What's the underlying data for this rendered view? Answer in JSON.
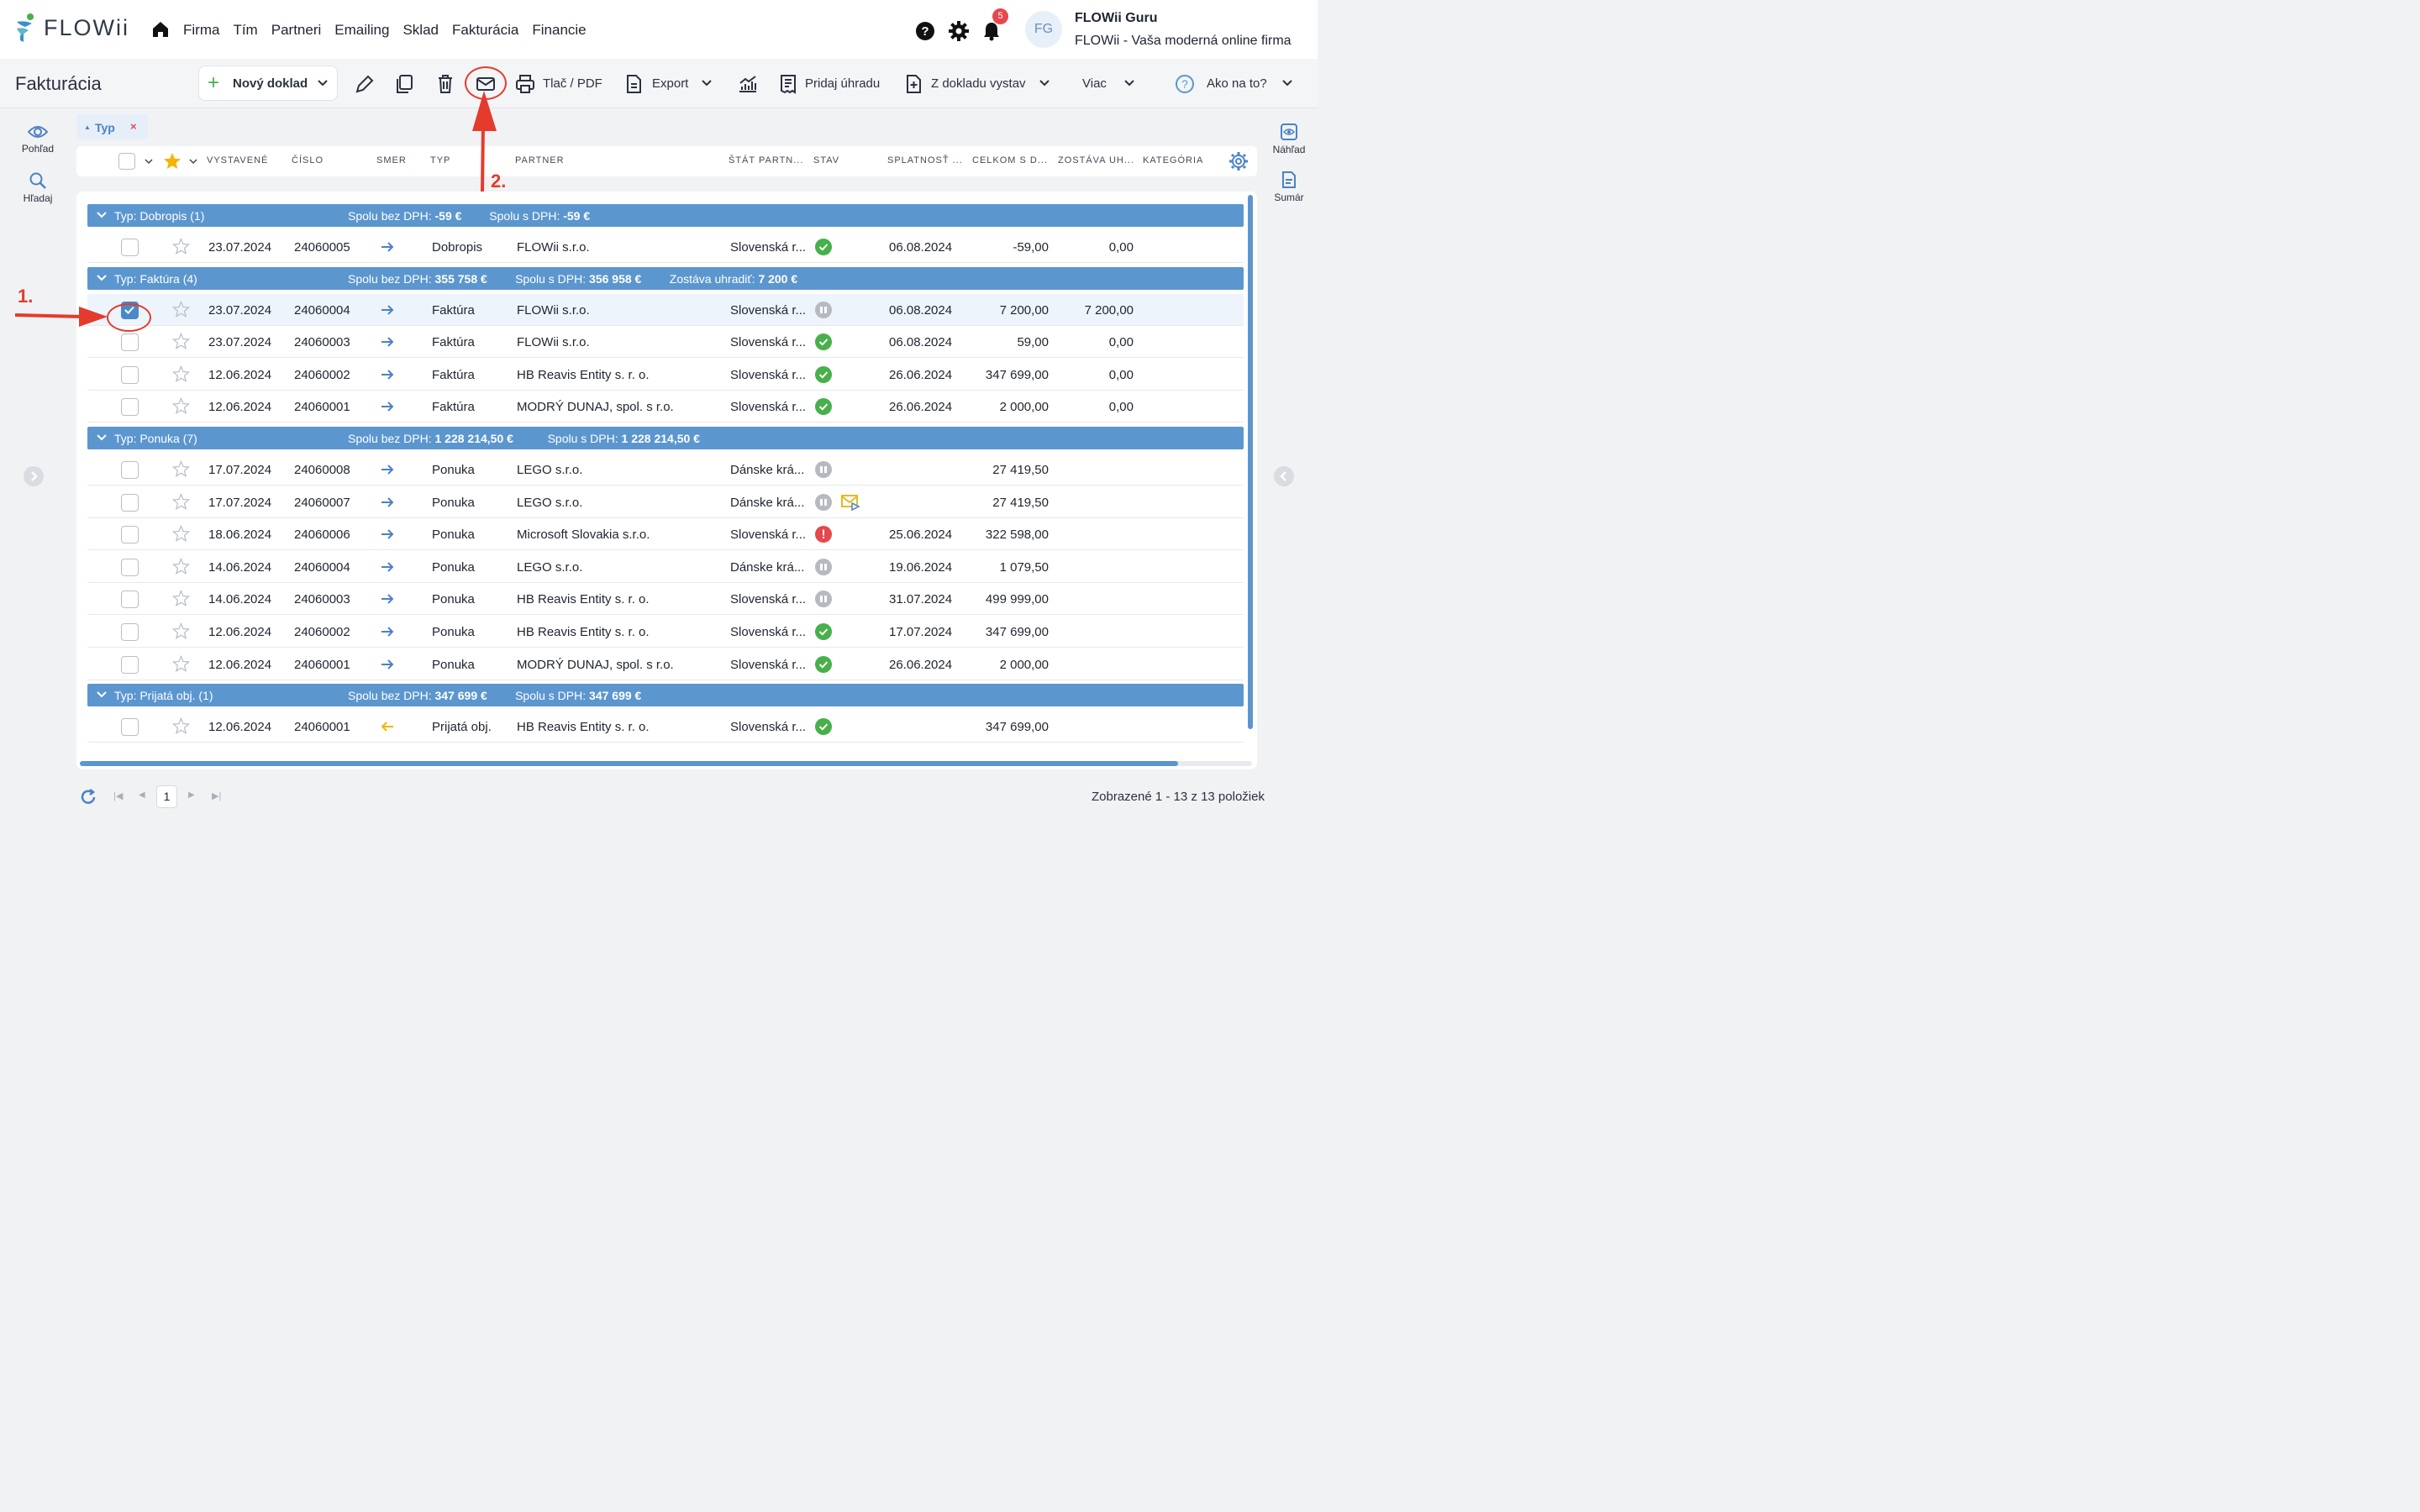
{
  "app": {
    "logo_text": "FLOWii",
    "nav": [
      "Firma",
      "Tím",
      "Partneri",
      "Emailing",
      "Sklad",
      "Fakturácia",
      "Financie"
    ],
    "notifications_count": "5",
    "avatar_initials": "FG",
    "user_name": "FLOWii Guru",
    "user_firm": "FLOWii - Vaša moderná online firma"
  },
  "toolbar": {
    "title": "Fakturácia",
    "new_doc": "Nový doklad",
    "print": "Tlač / PDF",
    "export": "Export",
    "add_payment": "Pridaj úhradu",
    "from_doc": "Z dokladu vystav",
    "more": "Viac",
    "help": "Ako na to?"
  },
  "sidebar_left": {
    "view": "Pohľad",
    "search": "Hľadaj"
  },
  "sidebar_right": {
    "preview": "Náhľad",
    "summary": "Sumár"
  },
  "filter_chip": {
    "label": "Typ",
    "remove": "×"
  },
  "columns": [
    "VYSTAVENÉ",
    "ČÍSLO",
    "SMER",
    "TYP",
    "PARTNER",
    "ŠTÁT PARTN...",
    "STAV",
    "SPLATNOSŤ ...",
    "CELKOM S D...",
    "ZOSTÁVA UH...",
    "KATEGÓRIA"
  ],
  "groups": [
    {
      "title": "Typ: Dobropis (1)",
      "sums": [
        {
          "label": "Spolu bez DPH:",
          "value": "-59 €"
        },
        {
          "label": "Spolu s DPH:",
          "value": "-59 €"
        }
      ],
      "rows": [
        {
          "date": "23.07.2024",
          "number": "24060005",
          "dir": "out",
          "type": "Dobropis",
          "partner": "FLOWii s.r.o.",
          "country": "Slovenská r...",
          "status": "paid",
          "due": "06.08.2024",
          "total": "-59,00",
          "remaining": "0,00",
          "checked": false
        }
      ]
    },
    {
      "title": "Typ: Faktúra (4)",
      "sums": [
        {
          "label": "Spolu bez DPH:",
          "value": "355 758 €"
        },
        {
          "label": "Spolu s DPH:",
          "value": "356 958 €"
        },
        {
          "label": "Zostáva uhradiť:",
          "value": "7 200 €"
        }
      ],
      "rows": [
        {
          "date": "23.07.2024",
          "number": "24060004",
          "dir": "out",
          "type": "Faktúra",
          "partner": "FLOWii s.r.o.",
          "country": "Slovenská r...",
          "status": "pending",
          "due": "06.08.2024",
          "total": "7 200,00",
          "remaining": "7 200,00",
          "checked": true
        },
        {
          "date": "23.07.2024",
          "number": "24060003",
          "dir": "out",
          "type": "Faktúra",
          "partner": "FLOWii s.r.o.",
          "country": "Slovenská r...",
          "status": "paid",
          "due": "06.08.2024",
          "total": "59,00",
          "remaining": "0,00",
          "checked": false
        },
        {
          "date": "12.06.2024",
          "number": "24060002",
          "dir": "out",
          "type": "Faktúra",
          "partner": "HB Reavis Entity s. r. o.",
          "country": "Slovenská r...",
          "status": "paid",
          "due": "26.06.2024",
          "total": "347 699,00",
          "remaining": "0,00",
          "checked": false
        },
        {
          "date": "12.06.2024",
          "number": "24060001",
          "dir": "out",
          "type": "Faktúra",
          "partner": "MODRÝ DUNAJ, spol. s r.o.",
          "country": "Slovenská r...",
          "status": "paid",
          "due": "26.06.2024",
          "total": "2 000,00",
          "remaining": "0,00",
          "checked": false
        }
      ]
    },
    {
      "title": "Typ: Ponuka (7)",
      "sums": [
        {
          "label": "Spolu bez DPH:",
          "value": "1 228 214,50 €"
        },
        {
          "label": "Spolu s DPH:",
          "value": "1 228 214,50 €"
        }
      ],
      "rows": [
        {
          "date": "17.07.2024",
          "number": "24060008",
          "dir": "out",
          "type": "Ponuka",
          "partner": "LEGO s.r.o.",
          "country": "Dánske krá...",
          "status": "pending",
          "due": "",
          "total": "27 419,50",
          "remaining": "",
          "checked": false
        },
        {
          "date": "17.07.2024",
          "number": "24060007",
          "dir": "out",
          "type": "Ponuka",
          "partner": "LEGO s.r.o.",
          "country": "Dánske krá...",
          "status": "pending",
          "sent": true,
          "due": "",
          "total": "27 419,50",
          "remaining": "",
          "checked": false
        },
        {
          "date": "18.06.2024",
          "number": "24060006",
          "dir": "out",
          "type": "Ponuka",
          "partner": "Microsoft Slovakia s.r.o.",
          "country": "Slovenská r...",
          "status": "error",
          "due": "25.06.2024",
          "total": "322 598,00",
          "remaining": "",
          "checked": false
        },
        {
          "date": "14.06.2024",
          "number": "24060004",
          "dir": "out",
          "type": "Ponuka",
          "partner": "LEGO s.r.o.",
          "country": "Dánske krá...",
          "status": "pending",
          "due": "19.06.2024",
          "total": "1 079,50",
          "remaining": "",
          "checked": false
        },
        {
          "date": "14.06.2024",
          "number": "24060003",
          "dir": "out",
          "type": "Ponuka",
          "partner": "HB Reavis Entity s. r. o.",
          "country": "Slovenská r...",
          "status": "pending",
          "due": "31.07.2024",
          "total": "499 999,00",
          "remaining": "",
          "checked": false
        },
        {
          "date": "12.06.2024",
          "number": "24060002",
          "dir": "out",
          "type": "Ponuka",
          "partner": "HB Reavis Entity s. r. o.",
          "country": "Slovenská r...",
          "status": "paid",
          "due": "17.07.2024",
          "total": "347 699,00",
          "remaining": "",
          "checked": false
        },
        {
          "date": "12.06.2024",
          "number": "24060001",
          "dir": "out",
          "type": "Ponuka",
          "partner": "MODRÝ DUNAJ, spol. s r.o.",
          "country": "Slovenská r...",
          "status": "paid",
          "due": "26.06.2024",
          "total": "2 000,00",
          "remaining": "",
          "checked": false
        }
      ]
    },
    {
      "title": "Typ: Prijatá obj. (1)",
      "sums": [
        {
          "label": "Spolu bez DPH:",
          "value": "347 699 €"
        },
        {
          "label": "Spolu s DPH:",
          "value": "347 699 €"
        }
      ],
      "rows": [
        {
          "date": "12.06.2024",
          "number": "24060001",
          "dir": "in",
          "type": "Prijatá obj.",
          "partner": "HB Reavis Entity s. r. o.",
          "country": "Slovenská r...",
          "status": "paid",
          "due": "",
          "total": "347 699,00",
          "remaining": "",
          "checked": false
        }
      ]
    }
  ],
  "pager": {
    "page": "1",
    "count_text": "Zobrazené 1 - 13 z 13 položiek"
  },
  "annotations": {
    "step1": "1.",
    "step2": "2."
  },
  "colors": {
    "accent": "#5b96cf",
    "paid": "#47b04b",
    "pending": "#b5b9c0",
    "error": "#e5484d",
    "annotation": "#e53b2c"
  }
}
